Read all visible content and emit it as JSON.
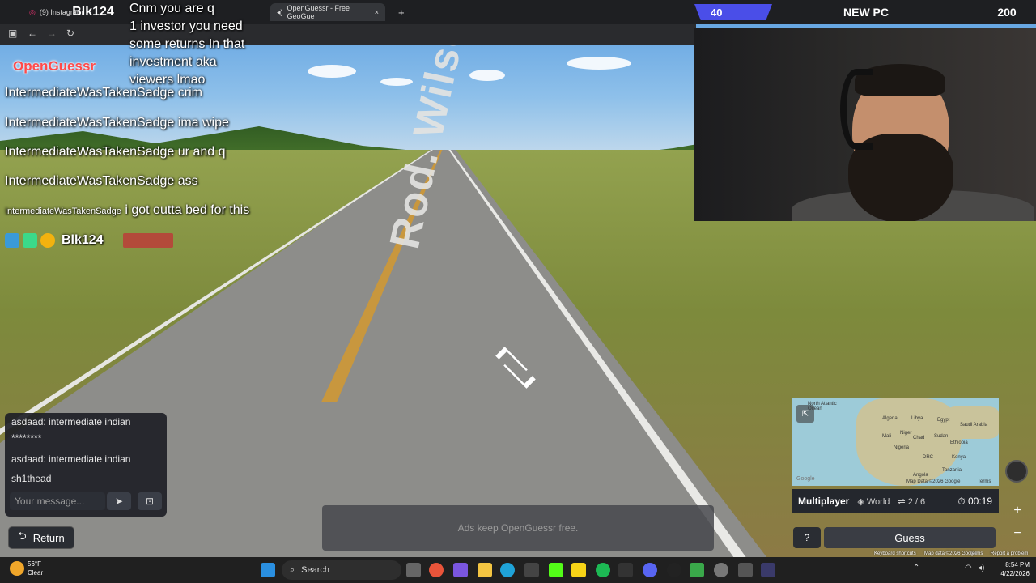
{
  "browser": {
    "tab_instagram": "(9) Instagram",
    "tab_active": "OpenGuessr - Free GeoGue",
    "tab_close": "×",
    "new_tab": "+"
  },
  "overlay": {
    "streamer_name_top": "Blk124",
    "top_text_lines": [
      "Cnm you are q",
      "1 investor you need",
      "some returns In that",
      "investment aka",
      "viewers lmao"
    ],
    "banner_count_left": "40",
    "banner_new_pc": "NEW PC",
    "banner_count_right": "200",
    "brand": "OpenGuessr"
  },
  "chat_overlay": [
    {
      "user": "IntermediateWasTakenSadge",
      "text": "crim"
    },
    {
      "user": "IntermediateWasTakenSadge",
      "text": "ima wipe"
    },
    {
      "user": "IntermediateWasTakenSadge",
      "text": "ur and q"
    },
    {
      "user": "IntermediateWasTakenSadge",
      "text": "ass"
    },
    {
      "user": "IntermediateWasTakenSadge",
      "text": "i got outta bed for this"
    }
  ],
  "streamer_line": {
    "name": "Blk124"
  },
  "road_text": "Rod. Wilson Pinhe",
  "chat_panel": {
    "messages": [
      {
        "line1": "asdaad: intermediate indian",
        "line2": "********"
      },
      {
        "line1": "asdaad: intermediate indian",
        "line2": "sh1thead"
      }
    ],
    "input_placeholder": "Your message...",
    "send_icon": "➤",
    "expand_icon": "⊡"
  },
  "return_button": {
    "icon": "⮌",
    "label": "Return"
  },
  "ads_text": "Ads keep OpenGuessr free.",
  "map": {
    "labels": [
      "Algeria",
      "Libya",
      "Egypt",
      "Mali",
      "Niger",
      "Chad",
      "Sudan",
      "Nigeria",
      "Ethiopia",
      "Saudi Arabia",
      "Kenya",
      "Tanzania",
      "DRC",
      "Angola",
      "North Atlantic Ocean"
    ],
    "footer": "Map Data ©2026 Google",
    "terms": "Terms",
    "logo": "Google"
  },
  "multiplayer_bar": {
    "mode": "Multiplayer",
    "region": "World",
    "round": "2 / 6",
    "timer": "00:19"
  },
  "guess_row": {
    "help": "?",
    "guess": "Guess"
  },
  "zoom": {
    "plus": "+",
    "minus": "−"
  },
  "google_footer": {
    "shortcuts": "Keyboard shortcuts",
    "data": "Map data ©2026 Google",
    "terms": "Terms",
    "report": "Report a problem"
  },
  "taskbar": {
    "weather_temp": "56°F",
    "weather_desc": "Clear",
    "search": "Search",
    "time": "8:54 PM",
    "date": "4/22/2026"
  }
}
